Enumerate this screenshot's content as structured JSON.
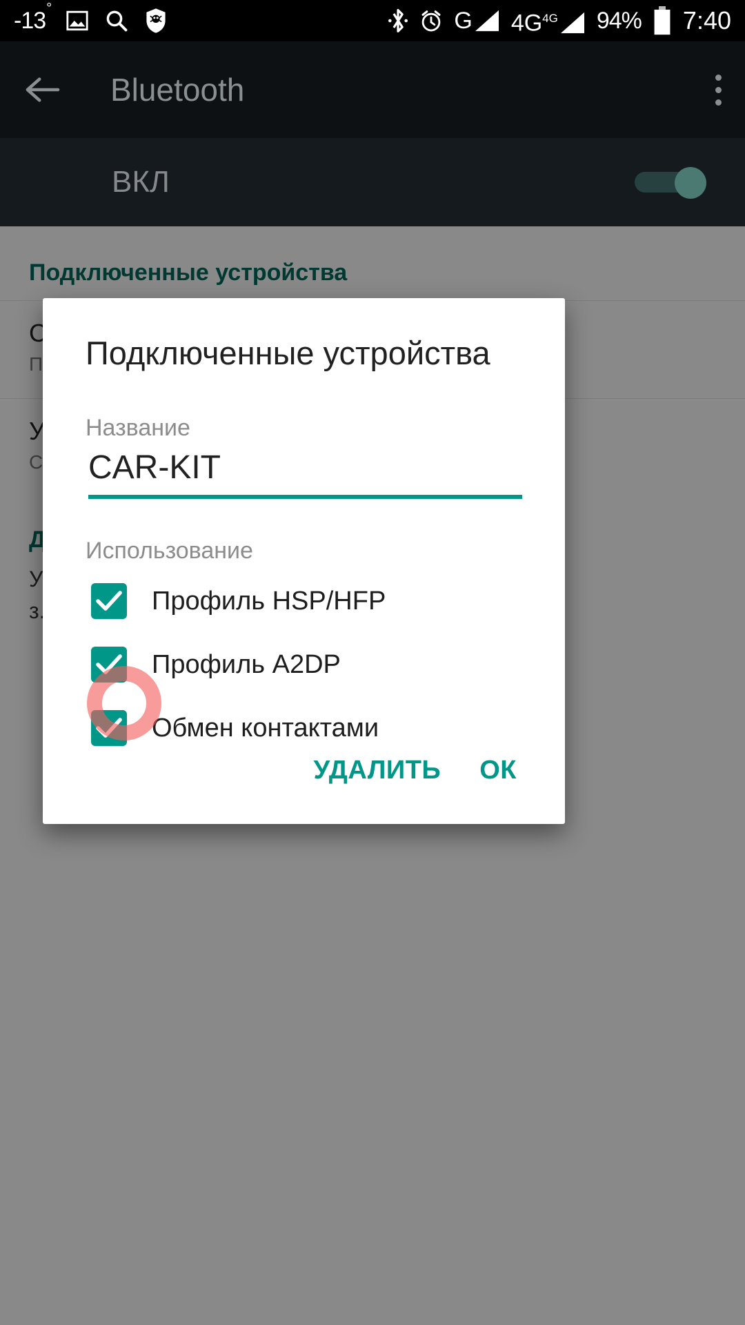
{
  "status_bar": {
    "temperature": "-13",
    "degree": "°",
    "icons_left": [
      "image-icon",
      "search-icon",
      "shield-icon"
    ],
    "icons_right": [
      "bluetooth-icon",
      "alarm-icon"
    ],
    "network_1_label": "G",
    "network_2_label": "4G",
    "network_2_sup": "4G",
    "battery_percent": "94%",
    "clock": "7:40"
  },
  "app_bar": {
    "back_icon": "back-arrow-icon",
    "title": "Bluetooth",
    "overflow_icon": "overflow-menu-icon"
  },
  "toggle_row": {
    "label": "ВКЛ",
    "state": "on"
  },
  "page": {
    "section_connected": "Подключенные устройства",
    "device_rows": [
      {
        "name": "CAR-KIT",
        "sub": "Подключено"
      },
      {
        "name": "Устройство",
        "sub": "Сопряжено"
      }
    ],
    "section_available": "Доступные устройства",
    "paragraph_line1": "Убедитесь, что устройство включено и",
    "paragraph_line2": "з..."
  },
  "dialog": {
    "title": "Подключенные устройства",
    "name_label": "Название",
    "name_value": "CAR-KIT",
    "usage_label": "Использование",
    "checkboxes": [
      {
        "label": "Профиль HSP/HFP",
        "checked": true
      },
      {
        "label": "Профиль A2DP",
        "checked": true
      },
      {
        "label": "Обмен контактами",
        "checked": true
      }
    ],
    "delete_label": "УДАЛИТЬ",
    "ok_label": "ОК"
  },
  "annotation": {
    "shape": "circle-highlight",
    "color": "#f45d5d",
    "target": "Обмен контактами checkbox"
  },
  "colors": {
    "accent": "#009688",
    "section_header": "#00695c",
    "status_bar_bg": "#000000",
    "app_bar_bg": "#0d1113",
    "toggle_row_bg": "#141a1d",
    "dialog_bg": "#ffffff",
    "annotation": "#f45d5d"
  }
}
